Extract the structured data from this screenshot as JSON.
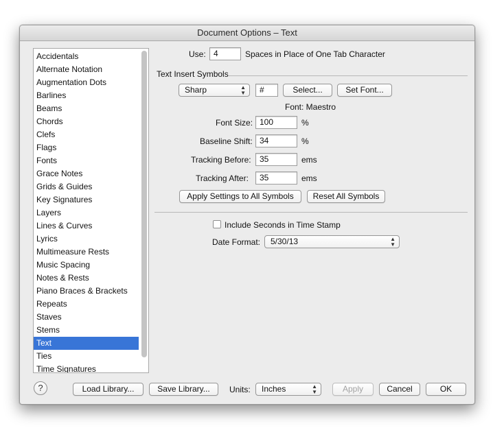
{
  "window": {
    "title": "Document Options – Text"
  },
  "sidebar": {
    "items": [
      {
        "label": "Accidentals"
      },
      {
        "label": "Alternate Notation"
      },
      {
        "label": "Augmentation Dots"
      },
      {
        "label": "Barlines"
      },
      {
        "label": "Beams"
      },
      {
        "label": "Chords"
      },
      {
        "label": "Clefs"
      },
      {
        "label": "Flags"
      },
      {
        "label": "Fonts"
      },
      {
        "label": "Grace Notes"
      },
      {
        "label": "Grids & Guides"
      },
      {
        "label": "Key Signatures"
      },
      {
        "label": "Layers"
      },
      {
        "label": "Lines & Curves"
      },
      {
        "label": "Lyrics"
      },
      {
        "label": "Multimeasure Rests"
      },
      {
        "label": "Music Spacing"
      },
      {
        "label": "Notes & Rests"
      },
      {
        "label": "Piano Braces & Brackets"
      },
      {
        "label": "Repeats"
      },
      {
        "label": "Staves"
      },
      {
        "label": "Stems"
      },
      {
        "label": "Text"
      },
      {
        "label": "Ties"
      },
      {
        "label": "Time Signatures"
      }
    ],
    "selected": "Text"
  },
  "tabs": {
    "use_label": "Use:",
    "use_value": "4",
    "use_desc": "Spaces in Place of One Tab Character"
  },
  "symbols": {
    "section_title": "Text Insert Symbols",
    "symbol_select": "Sharp",
    "symbol_char": "#",
    "select_button": "Select...",
    "set_font_button": "Set Font...",
    "font_info": "Font: Maestro",
    "font_size_label": "Font Size:",
    "font_size_value": "100",
    "font_size_unit": "%",
    "baseline_label": "Baseline Shift:",
    "baseline_value": "34",
    "baseline_unit": "%",
    "tracking_before_label": "Tracking Before:",
    "tracking_before_value": "35",
    "tracking_before_unit": "ems",
    "tracking_after_label": "Tracking After:",
    "tracking_after_value": "35",
    "tracking_after_unit": "ems",
    "apply_all_button": "Apply Settings to All Symbols",
    "reset_all_button": "Reset All Symbols"
  },
  "timestamp": {
    "include_seconds_label": "Include Seconds in Time Stamp",
    "include_seconds_checked": false,
    "date_format_label": "Date Format:",
    "date_format_value": "5/30/13"
  },
  "footer": {
    "help_label": "?",
    "load_library": "Load Library...",
    "save_library": "Save Library...",
    "units_label": "Units:",
    "units_value": "Inches",
    "apply": "Apply",
    "cancel": "Cancel",
    "ok": "OK"
  },
  "colors": {
    "selection": "#3875d7",
    "window_bg": "#ececec"
  },
  "icons": {
    "help": "help-icon",
    "popup_arrows": "updown-arrows-icon"
  }
}
